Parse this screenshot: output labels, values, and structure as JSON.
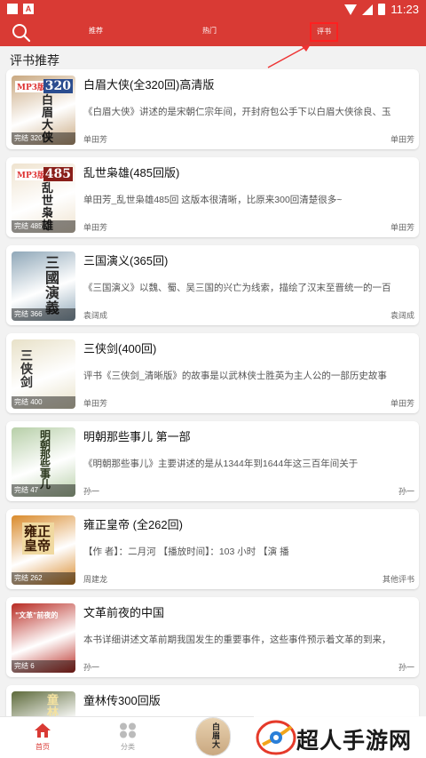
{
  "status": {
    "time": "11:23",
    "app_badge": "A"
  },
  "toolbar": {
    "tabs": [
      {
        "label": "推荐"
      },
      {
        "label": "热门"
      },
      {
        "label": "评书"
      }
    ]
  },
  "section": {
    "title": "评书推荐"
  },
  "books": [
    {
      "title": "白眉大侠(全320回)高清版",
      "desc": "《白眉大侠》讲述的是宋朝仁宗年间，开封府包公手下以白眉大侠徐良、玉",
      "author": "单田芳",
      "category": "单田芳",
      "status": "完结 320",
      "cover_text": "白眉大侠",
      "cover_num": "320",
      "cover_tag": "MP3版",
      "cover_color": "#c9a880"
    },
    {
      "title": "乱世枭雄(485回版)",
      "desc": "单田芳_乱世枭雄485回  这版本很清晰，比原来300回清楚很多~",
      "author": "单田芳",
      "category": "单田芳",
      "status": "完结 485",
      "cover_text": "乱世枭雄",
      "cover_num": "485",
      "cover_tag": "MP3版",
      "cover_color": "#efe3cf"
    },
    {
      "title": "三国演义(365回)",
      "desc": "《三国演义》以魏、蜀、吴三国的兴亡为线索，描绘了汉末至晋统一的一百",
      "author": "袁阔成",
      "category": "袁阔成",
      "status": "完结 366",
      "cover_text": "三國演義",
      "cover_num": "",
      "cover_tag": "",
      "cover_color": "#8fa7b8"
    },
    {
      "title": "三侠剑(400回)",
      "desc": "评书《三侠剑_清晰版》的故事是以武林侠士胜英为主人公的一部历史故事",
      "author": "单田芳",
      "category": "单田芳",
      "status": "完结 400",
      "cover_text": "三侠剑",
      "cover_num": "",
      "cover_tag": "",
      "cover_color": "#e8e1c8"
    },
    {
      "title": "明朝那些事儿 第一部",
      "desc": "《明朝那些事儿》主要讲述的是从1344年到1644年这三百年间关于",
      "author": "孙一",
      "category": "孙一",
      "status": "完结 47",
      "cover_text": "明朝那些事儿",
      "cover_num": "",
      "cover_tag": "",
      "cover_color": "#b7cfa8"
    },
    {
      "title": "雍正皇帝 (全262回)",
      "desc": "【作    者】：二月河  【播放时间】：103    小时  【演  播",
      "author": "周建龙",
      "category": "其他评书",
      "status": "完结 262",
      "cover_text": "雍正皇帝",
      "cover_num": "",
      "cover_tag": "",
      "cover_color": "#d98a2b"
    },
    {
      "title": "文革前夜的中国",
      "desc": "本书详细讲述文革前期我国发生的重要事件，这些事件预示着文革的到来，",
      "author": "孙一",
      "category": "孙一",
      "status": "完结 6",
      "cover_text": "\"文革\"前夜的",
      "cover_num": "",
      "cover_tag": "",
      "cover_color": "#b82a22"
    },
    {
      "title": "童林传300回版",
      "desc": "",
      "author": "",
      "category": "",
      "status": "",
      "cover_text": "童林",
      "cover_num": "",
      "cover_tag": "",
      "cover_color": "#5d6a3a"
    }
  ],
  "bottom_nav": {
    "home_label": "首页",
    "category_label": "分类",
    "player_cover_text": "白眉大"
  },
  "watermark": {
    "text": "超人手游网"
  },
  "colors": {
    "brand_red": "#d93a34",
    "highlight_box": "#ff2020",
    "background": "#f2f2f2"
  }
}
